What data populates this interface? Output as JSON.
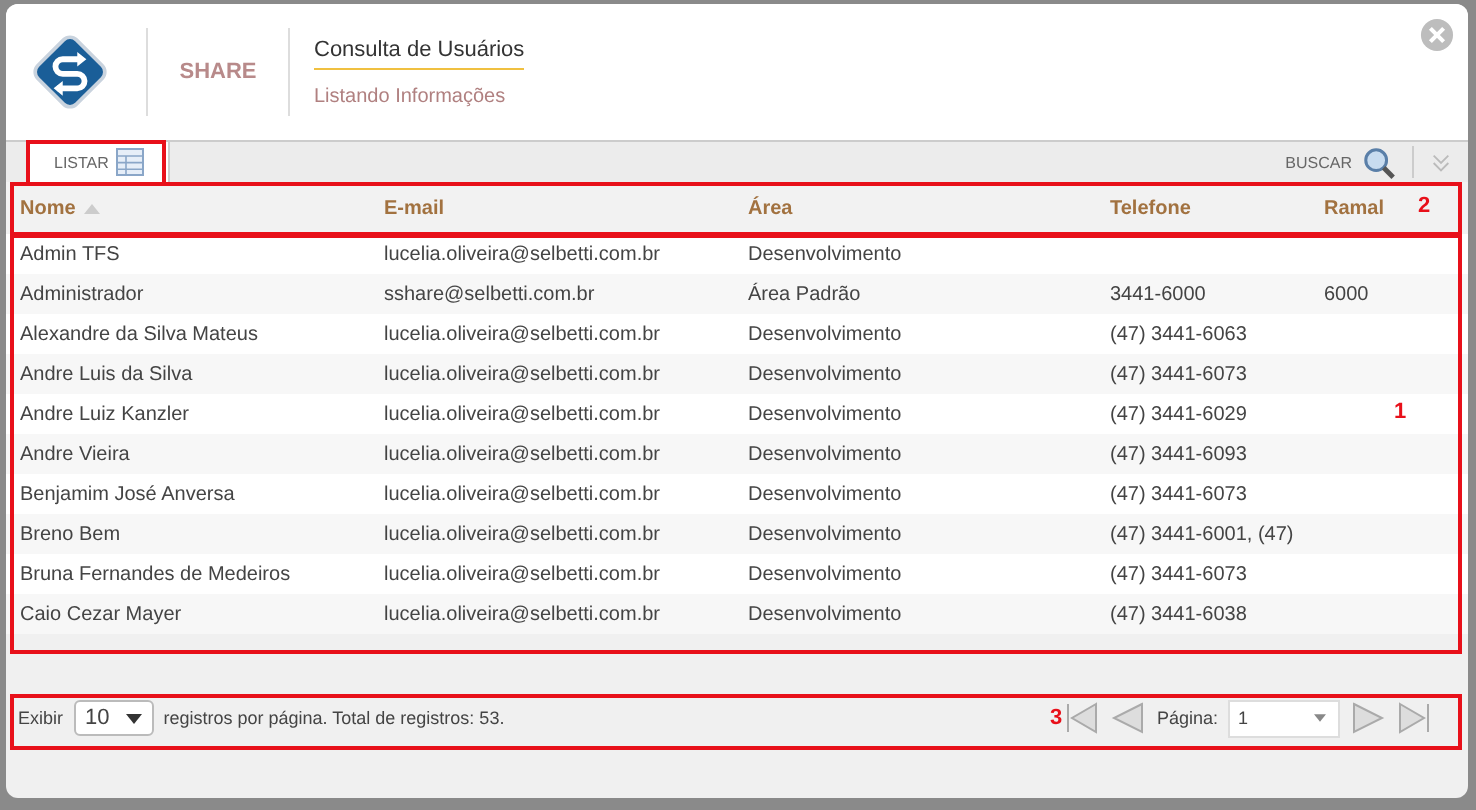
{
  "header": {
    "brand": "SHARE",
    "title": "Consulta de Usuários",
    "subtitle": "Listando Informações"
  },
  "tabs": [
    {
      "label": "LISTAR",
      "selected": true
    }
  ],
  "search": {
    "label": "BUSCAR"
  },
  "table": {
    "columns": [
      {
        "label": "Nome",
        "sorted": true
      },
      {
        "label": "E-mail",
        "sorted": false
      },
      {
        "label": "Área",
        "sorted": false
      },
      {
        "label": "Telefone",
        "sorted": false
      },
      {
        "label": "Ramal",
        "sorted": false
      }
    ],
    "rows": [
      [
        "Admin TFS",
        "lucelia.oliveira@selbetti.com.br",
        "Desenvolvimento",
        "",
        ""
      ],
      [
        "Administrador",
        "sshare@selbetti.com.br",
        "Área Padrão",
        "3441-6000",
        "6000"
      ],
      [
        "Alexandre da Silva Mateus",
        "lucelia.oliveira@selbetti.com.br",
        "Desenvolvimento",
        "(47) 3441-6063",
        ""
      ],
      [
        "Andre Luis da Silva",
        "lucelia.oliveira@selbetti.com.br",
        "Desenvolvimento",
        "(47) 3441-6073",
        ""
      ],
      [
        "Andre Luiz Kanzler",
        "lucelia.oliveira@selbetti.com.br",
        "Desenvolvimento",
        "(47) 3441-6029",
        ""
      ],
      [
        "Andre Vieira",
        "lucelia.oliveira@selbetti.com.br",
        "Desenvolvimento",
        "(47) 3441-6093",
        ""
      ],
      [
        "Benjamim José Anversa",
        "lucelia.oliveira@selbetti.com.br",
        "Desenvolvimento",
        "(47) 3441-6073",
        ""
      ],
      [
        "Breno Bem",
        "lucelia.oliveira@selbetti.com.br",
        "Desenvolvimento",
        "(47) 3441-6001, (47)",
        ""
      ],
      [
        "Bruna Fernandes de Medeiros",
        "lucelia.oliveira@selbetti.com.br",
        "Desenvolvimento",
        "(47) 3441-6073",
        ""
      ],
      [
        "Caio Cezar Mayer",
        "lucelia.oliveira@selbetti.com.br",
        "Desenvolvimento",
        "(47) 3441-6038",
        ""
      ]
    ]
  },
  "footer": {
    "show_label": "Exibir",
    "per_page": "10",
    "summary": "registros por página. Total de registros: 53.",
    "page_label": "Página:",
    "page": "1"
  },
  "annotations": [
    {
      "label": "1"
    },
    {
      "label": "2"
    },
    {
      "label": "3"
    }
  ]
}
